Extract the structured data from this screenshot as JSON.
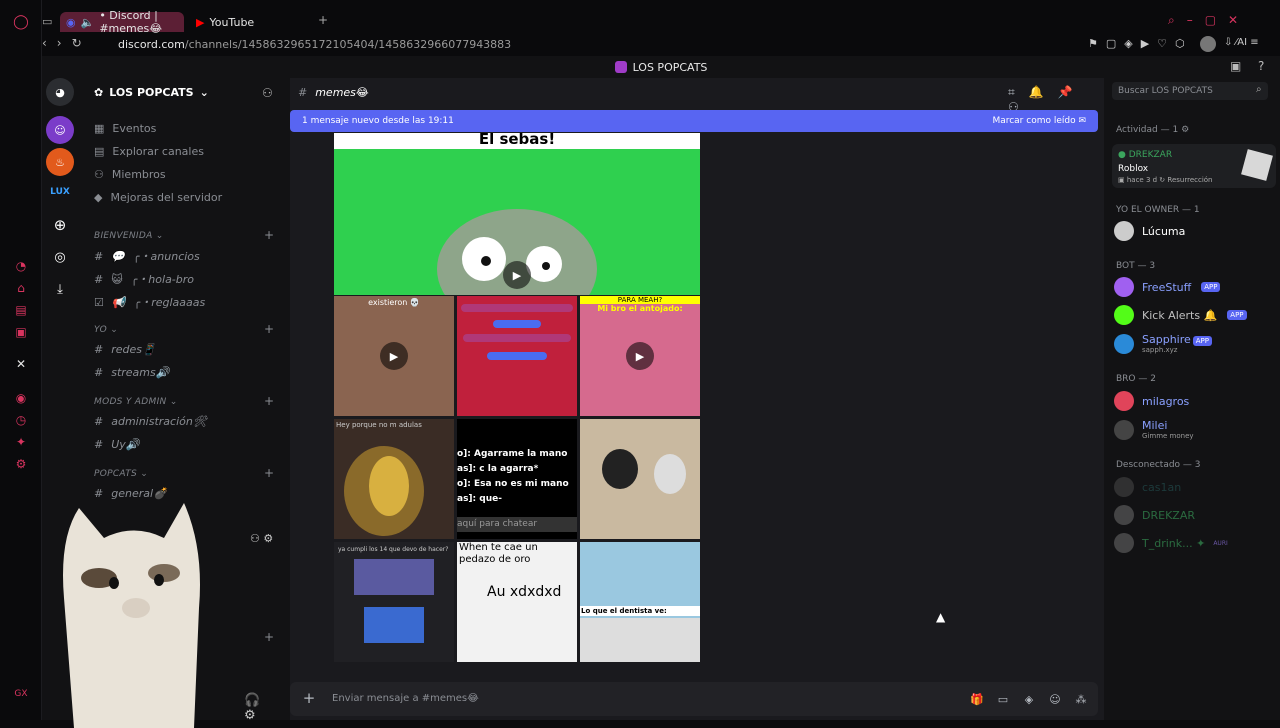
{
  "browser": {
    "tabs": [
      {
        "label": "• Discord | #memes😂"
      },
      {
        "label": "YouTube"
      }
    ],
    "url_host": "discord.com",
    "url_path": "/channels/1458632965172105404/1458632966077943883"
  },
  "discord": {
    "top_title": "LOS POPCATS",
    "server_name": "LOS POPCATS",
    "nav": [
      "Eventos",
      "Explorar canales",
      "Miembros",
      "Mejoras del servidor"
    ],
    "categories": [
      {
        "name": "BIENVENIDA",
        "channels": [
          "╭・anuncios",
          "╭・hola-bro",
          "╭・reglaaaas"
        ]
      },
      {
        "name": "YO",
        "channels": [
          "redes📱",
          "streams🔊"
        ]
      },
      {
        "name": "MODS Y ADMIN",
        "channels": [
          "administración🛠",
          "Uy🔊"
        ]
      },
      {
        "name": "POPCATS",
        "channels": [
          "general💣"
        ]
      }
    ],
    "channel_header": "memes😂",
    "new_msg_banner": "1 mensaje nuevo desde las 19:11",
    "mark_read": "Marcar como leído",
    "search_placeholder": "Buscar LOS POPCATS",
    "message_placeholder": "Enviar mensaje a #memes😂",
    "media": {
      "main_caption": "El sebas!",
      "tile_texts": {
        "t1": "existieron 💀",
        "t3a": "PARA MEAH?",
        "t3b": "Mi bro el antojado:",
        "t5": "Hey porque no m adulas",
        "t6a": "o]: Agarrame la mano",
        "t6b": "as]: c la agarra*",
        "t6c": "o]: Esa no es mi mano",
        "t6d": "as]: que-",
        "t6e": "aquí para chatear",
        "t8": "ya cumpli los 14 que devo de hacer?",
        "t9a": "When te cae un",
        "t9b": "pedazo de oro",
        "t9c": "Au xdxdxd",
        "t10": "Lo que el dentista ve:"
      }
    },
    "members": {
      "activity_header": "Actividad — 1",
      "activity": {
        "name": "DREKZAR",
        "game": "Roblox",
        "time": "hace 3 d",
        "detail": "Resurrección"
      },
      "owner_header": "YO EL OWNER — 1",
      "owner": "Lúcuma",
      "bot_header": "BOT — 3",
      "bots": [
        {
          "name": "FreeStuff",
          "badge": "APP"
        },
        {
          "name": "Kick Alerts 🔔",
          "badge": "APP"
        },
        {
          "name": "Sapphire",
          "badge": "APP",
          "sub": "sapph.xyz"
        }
      ],
      "bro_header": "BRO — 2",
      "bros": [
        {
          "name": "milagros"
        },
        {
          "name": "Milei",
          "sub": "Gimme money"
        }
      ],
      "offline_header": "Desconectado — 3",
      "offline": [
        {
          "name": "cas1an"
        },
        {
          "name": "DREKZAR"
        },
        {
          "name": "T_drink... ✦",
          "tag": "AURI"
        }
      ]
    }
  },
  "colors": {
    "accent": "#5865f2",
    "opera": "#d8345f",
    "online": "#23a55a"
  }
}
